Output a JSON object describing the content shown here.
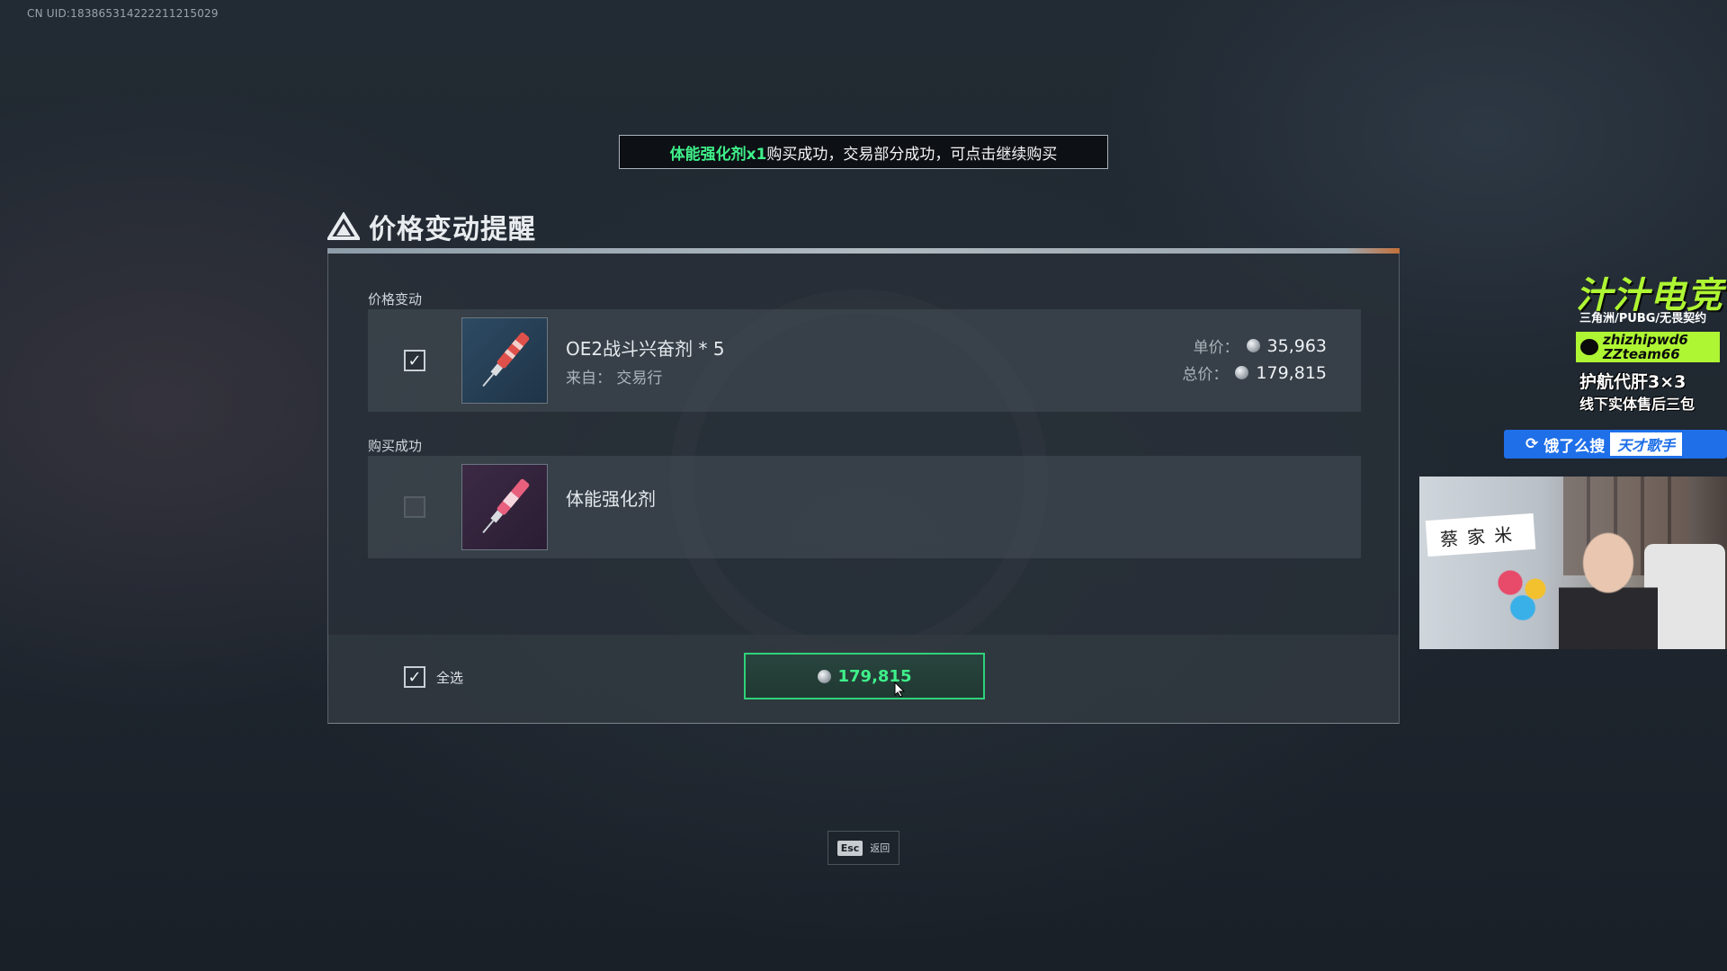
{
  "uid_text": "CN UID:183865314222211215029",
  "toast": {
    "highlight": "体能强化剂x1",
    "message": "购买成功，交易部分成功，可点击继续购买"
  },
  "dialog": {
    "title": "价格变动提醒",
    "section_changed": "价格变动",
    "section_success": "购买成功",
    "changed_item": {
      "checked": true,
      "name": "OE2战斗兴奋剂 * 5",
      "source": "来自：  交易行",
      "unit_price_label": "单价：",
      "unit_price": "35,963",
      "total_price_label": "总价：",
      "total_price": "179,815"
    },
    "success_item": {
      "checked": false,
      "name": "体能强化剂"
    },
    "select_all_label": "全选",
    "buy_total": "179,815"
  },
  "esc": {
    "key": "Esc",
    "label": "返回"
  },
  "overlay": {
    "brand": "汁汁电竞",
    "sub": "三角洲/PUBG/无畏契约",
    "wechat_line1": "zhizhipwd6",
    "wechat_line2": "ZZteam66",
    "service1": "护航代肝3×3",
    "service2": "线下实体售后三包",
    "search_prefix": "饿了么搜",
    "search_tag": "天才歌手",
    "cam_sign": "蔡家米"
  },
  "colors": {
    "accent_green": "#3ff08a",
    "overlay_green": "#aef533",
    "search_blue": "#1e6fe8"
  }
}
